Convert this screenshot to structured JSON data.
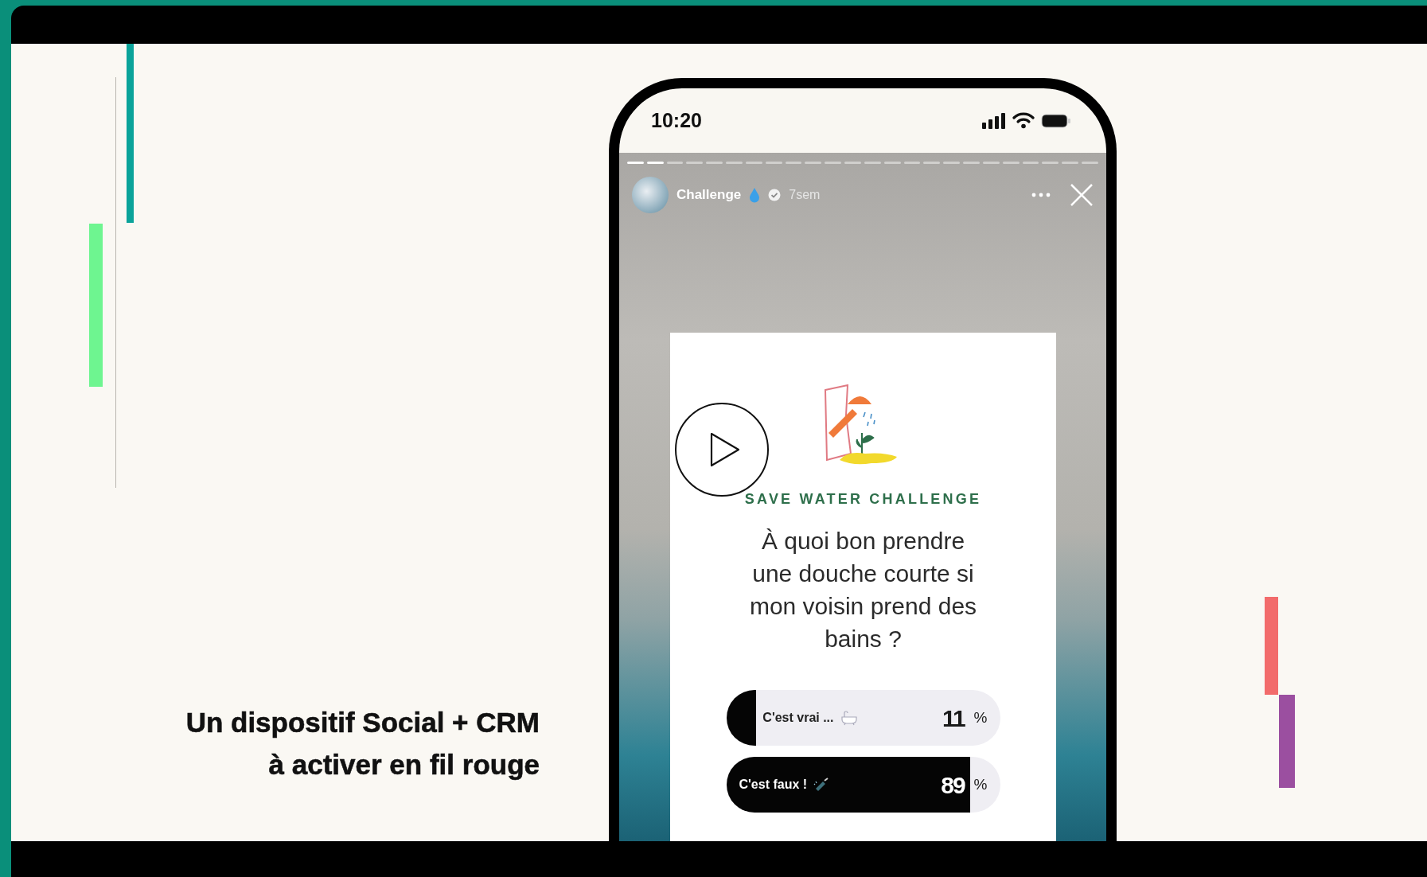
{
  "slide": {
    "headline_lines": [
      "Un dispositif Social + CRM",
      "à activer en fil rouge"
    ]
  },
  "phone": {
    "status_bar": {
      "time": "10:20"
    },
    "story": {
      "segments": [
        {
          "viewed": true
        },
        {
          "viewed": true
        },
        {
          "viewed": false
        },
        {
          "viewed": false
        },
        {
          "viewed": false
        },
        {
          "viewed": false
        },
        {
          "viewed": false
        },
        {
          "viewed": false
        },
        {
          "viewed": false
        },
        {
          "viewed": false
        },
        {
          "viewed": false
        },
        {
          "viewed": false
        },
        {
          "viewed": false
        },
        {
          "viewed": false
        },
        {
          "viewed": false
        },
        {
          "viewed": false
        },
        {
          "viewed": false
        },
        {
          "viewed": false
        },
        {
          "viewed": false
        },
        {
          "viewed": false
        },
        {
          "viewed": false
        },
        {
          "viewed": false
        },
        {
          "viewed": false
        },
        {
          "viewed": false
        }
      ],
      "account": "Challenge",
      "verified": true,
      "posted": "7sem",
      "card": {
        "title": "SAVE WATER CHALLENGE",
        "question": "À quoi bon prendre une douche courte si mon voisin prend des bains ?",
        "poll": [
          {
            "kind": "bath",
            "label": "C'est vrai ...",
            "percent": "11",
            "unit": "%",
            "level": 0.11
          },
          {
            "kind": "shower",
            "label": "C'est faux !",
            "percent": "89",
            "unit": "%",
            "level": 0.89
          }
        ]
      }
    }
  }
}
